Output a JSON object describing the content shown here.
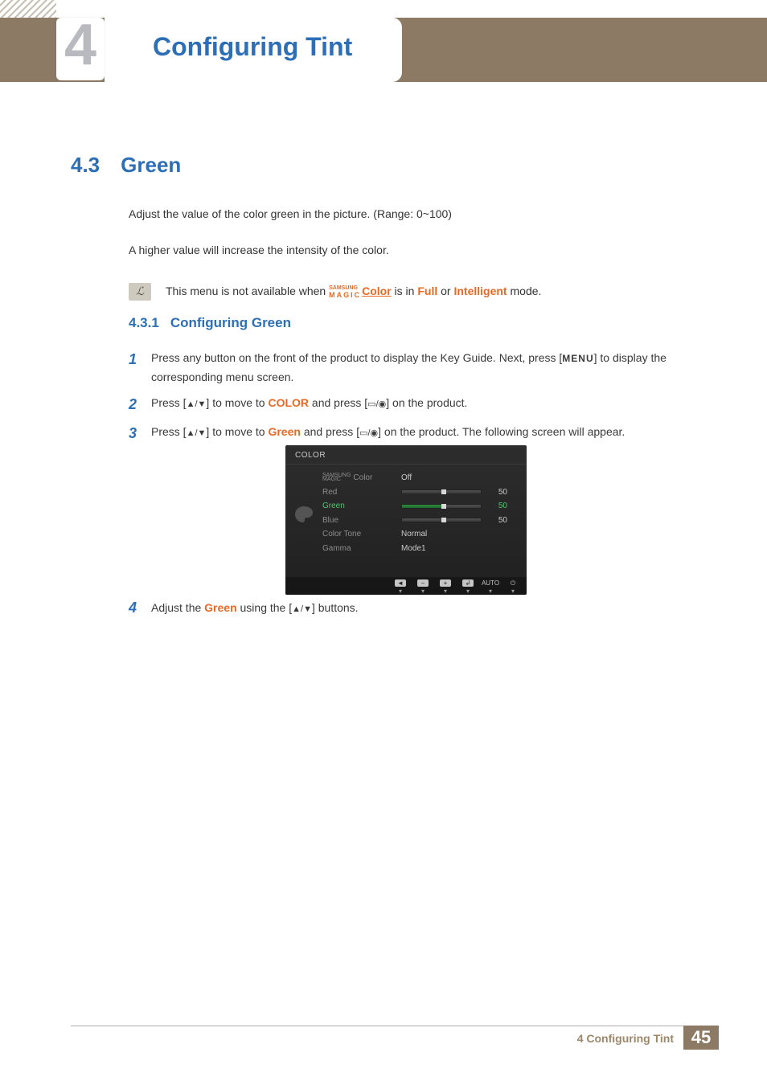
{
  "chapter": {
    "number": "4",
    "title": "Configuring Tint"
  },
  "section": {
    "number": "4.3",
    "title": "Green"
  },
  "paragraphs": {
    "p1": "Adjust the value of the color green in the picture. (Range: 0~100)",
    "p2": "A higher value will increase the intensity of the color."
  },
  "note": {
    "pre": "This menu is not available when ",
    "magic_top": "SAMSUNG",
    "magic_bot": "MAGIC",
    "brand_link": "Color",
    "mid": " is in ",
    "mode1": "Full",
    "or": " or ",
    "mode2": "Intelligent",
    "post": " mode."
  },
  "subsection": {
    "number": "4.3.1",
    "title": "Configuring Green"
  },
  "steps": {
    "s1a": "Press any button on the front of the product to display the Key Guide. Next, press [",
    "s1_menu": "MENU",
    "s1b": "] to display the corresponding menu screen.",
    "s2a": "Press [",
    "arrows": "▲/▼",
    "s2b": "] to move to ",
    "s2_target": "COLOR",
    "s2c": " and press [",
    "enter": "▭/◉",
    "s2d": "] on the product.",
    "s3a": "Press [",
    "s3b": "] to move to ",
    "s3_target": "Green",
    "s3c": " and press [",
    "s3d": "] on the product. The following screen will appear.",
    "s4a": "Adjust the ",
    "s4_target": "Green",
    "s4b": " using the [",
    "s4c": "] buttons."
  },
  "osd": {
    "title": "COLOR",
    "items": {
      "magic_color": "Color",
      "red": "Red",
      "green": "Green",
      "blue": "Blue",
      "color_tone": "Color Tone",
      "gamma": "Gamma"
    },
    "values": {
      "magic_color": "Off",
      "red": "50",
      "green": "50",
      "blue": "50",
      "color_tone": "Normal",
      "gamma": "Mode1"
    },
    "footer": {
      "back": "◄",
      "minus": "−",
      "plus": "+",
      "enter": "↲",
      "auto": "AUTO",
      "power": "⏻",
      "tri": "▾"
    }
  },
  "footer": {
    "label": "4 Configuring Tint",
    "page": "45"
  }
}
